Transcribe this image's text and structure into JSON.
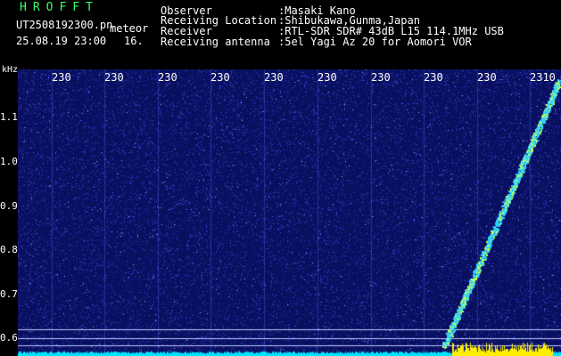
{
  "header": {
    "logo": "HROFFT",
    "filename": "UT2508192300.pn",
    "meteor_label": "meteor",
    "datetime": "25.08.19 23:00",
    "count": "16.",
    "info": [
      {
        "label": "Observer",
        "value": ":Masaki Kano"
      },
      {
        "label": "Receiving Location",
        "value": ":Shibukawa,Gunma,Japan"
      },
      {
        "label": "Receiver",
        "value": ":RTL-SDR SDR# 43dB L15 114.1MHz USB"
      },
      {
        "label": "Receiving antenna",
        "value": ":5el Yagi Az 20 for Aomori VOR"
      }
    ]
  },
  "axis": {
    "unit": "kHz",
    "time_ticks": [
      "230",
      "230",
      "230",
      "230",
      "230",
      "230",
      "230",
      "230",
      "230",
      "2310"
    ],
    "freq_ticks": [
      "1.1",
      "1.0",
      "0.9",
      "0.8",
      "0.7",
      "0.6"
    ]
  },
  "colors": {
    "background": "#0a1060",
    "noise": "#4a5cff",
    "signal": "#c8ff4a",
    "bottom_band": "#00e5ff",
    "marker_yellow": "#ffee00",
    "header_text": "#ffffff",
    "logo_green": "#33ff66"
  }
}
